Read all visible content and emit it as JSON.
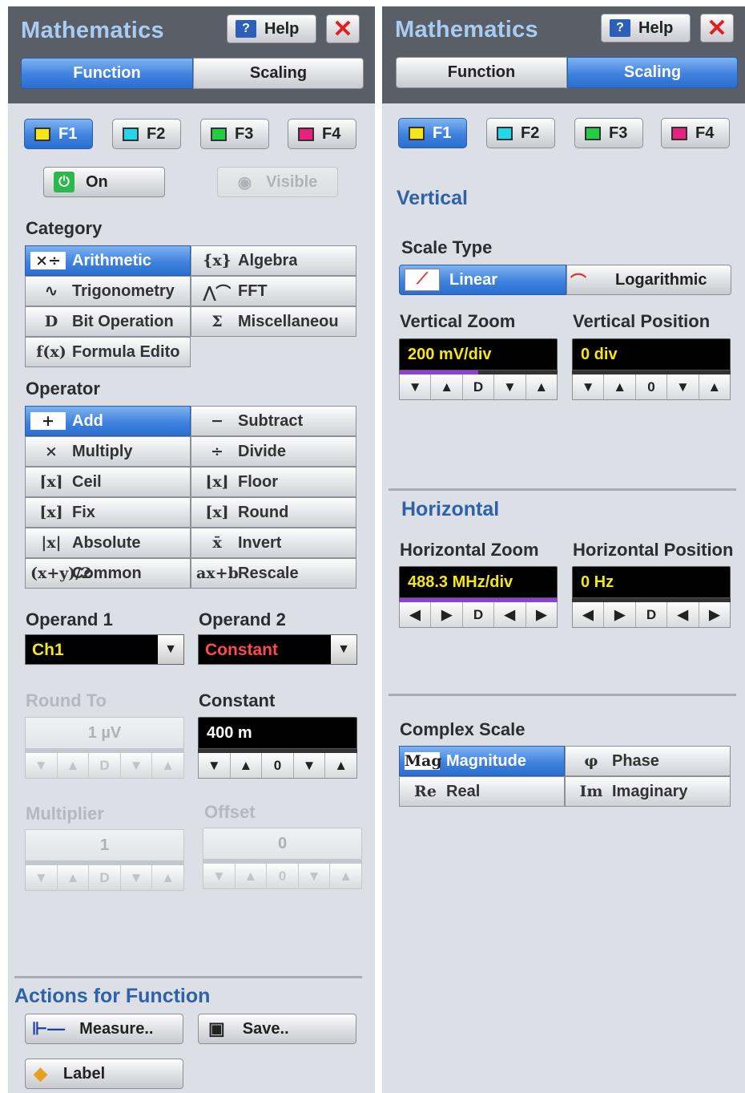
{
  "left": {
    "title": "Mathematics",
    "help": "Help",
    "tabs": [
      "Function",
      "Scaling"
    ],
    "functions": [
      "F1",
      "F2",
      "F3",
      "F4"
    ],
    "on": "On",
    "visible": "Visible",
    "category_label": "Category",
    "categories": [
      {
        "icon": "×÷",
        "label": "Arithmetic"
      },
      {
        "icon": "{x}",
        "label": "Algebra"
      },
      {
        "icon": "∿",
        "label": "Trigonometry"
      },
      {
        "icon": "⋀⌒",
        "label": "FFT"
      },
      {
        "icon": "D",
        "label": "Bit Operation"
      },
      {
        "icon": "Σ",
        "label": "Miscellaneou"
      },
      {
        "icon": "f(x)",
        "label": "Formula Edito"
      }
    ],
    "operator_label": "Operator",
    "operators": [
      {
        "icon": "+",
        "label": "Add"
      },
      {
        "icon": "−",
        "label": "Subtract"
      },
      {
        "icon": "×",
        "label": "Multiply"
      },
      {
        "icon": "÷",
        "label": "Divide"
      },
      {
        "icon": "⌈x⌉",
        "label": "Ceil"
      },
      {
        "icon": "⌊x⌋",
        "label": "Floor"
      },
      {
        "icon": "[x]",
        "label": "Fix"
      },
      {
        "icon": "[x]",
        "label": "Round"
      },
      {
        "icon": "|x|",
        "label": "Absolute"
      },
      {
        "icon": "x̄",
        "label": "Invert"
      },
      {
        "icon": "(x+y)/2",
        "label": "Common"
      },
      {
        "icon": "ax+b",
        "label": "Rescale"
      }
    ],
    "operand1_label": "Operand 1",
    "operand1": "Ch1",
    "operand2_label": "Operand 2",
    "operand2": "Constant",
    "roundto_label": "Round To",
    "roundto": "1 µV",
    "constant_label": "Constant",
    "constant": "400 m",
    "multiplier_label": "Multiplier",
    "multiplier": "1",
    "offset_label": "Offset",
    "offset": "0",
    "spin_d": "D",
    "spin_0": "0",
    "actions_label": "Actions for Function",
    "measure": "Measure..",
    "save": "Save..",
    "label": "Label"
  },
  "right": {
    "title": "Mathematics",
    "help": "Help",
    "tabs": [
      "Function",
      "Scaling"
    ],
    "functions": [
      "F1",
      "F2",
      "F3",
      "F4"
    ],
    "vertical_label": "Vertical",
    "scale_type_label": "Scale Type",
    "linear": "Linear",
    "logarithmic": "Logarithmic",
    "vzoom_label": "Vertical Zoom",
    "vzoom": "200 mV/div",
    "vpos_label": "Vertical Position",
    "vpos": "0 div",
    "horizontal_label": "Horizontal",
    "hzoom_label": "Horizontal Zoom",
    "hzoom": "488.3 MHz/div",
    "hpos_label": "Horizontal Position",
    "hpos": "0 Hz",
    "complex_label": "Complex Scale",
    "complex": [
      {
        "icon": "Mag",
        "label": "Magnitude"
      },
      {
        "icon": "φ",
        "label": "Phase"
      },
      {
        "icon": "Re",
        "label": "Real"
      },
      {
        "icon": "Im",
        "label": "Imaginary"
      }
    ],
    "spin_d": "D",
    "spin_0": "0"
  },
  "colors": {
    "f1": "#f5e61a",
    "f2": "#22d8e8",
    "f3": "#22cc44",
    "f4": "#e8227a",
    "accent": "#3f82de",
    "red_text": "#ff4a4a",
    "yellow_text": "#f5e61a"
  }
}
